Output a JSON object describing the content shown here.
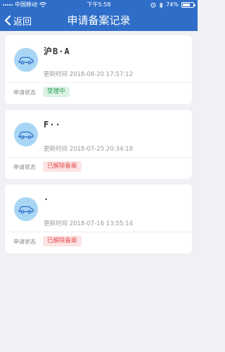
{
  "statusbar": {
    "carrier": "中国移动",
    "time": "下午5:58",
    "battery": "74%",
    "battery_level": 0.74
  },
  "navbar": {
    "back_label": "返回",
    "title": "申请备案记录"
  },
  "records": [
    {
      "plate": "沪B·A",
      "sub": "",
      "updated": "更新时间 2018-08-20 17:57:12",
      "status_label": "申请状态",
      "status": "受理中",
      "status_color": "#2f9e5b",
      "status_bg": "#dcf3e4"
    },
    {
      "plate": "F··",
      "sub": "",
      "updated": "更新时间 2018-07-25 20:34:18",
      "status_label": "申请状态",
      "status": "已解除备案",
      "status_color": "#e05252",
      "status_bg": "#fde3e3"
    },
    {
      "plate": "·",
      "sub": "",
      "updated": "更新时间 2018-07-16 13:55:14",
      "status_label": "申请状态",
      "status": "已解除备案",
      "status_color": "#e05252",
      "status_bg": "#fde3e3"
    }
  ],
  "colors": {
    "header_bg": "#2f6ec8",
    "avatar_bg": "#a9d6f5",
    "car_icon": "#2f6ec8"
  }
}
